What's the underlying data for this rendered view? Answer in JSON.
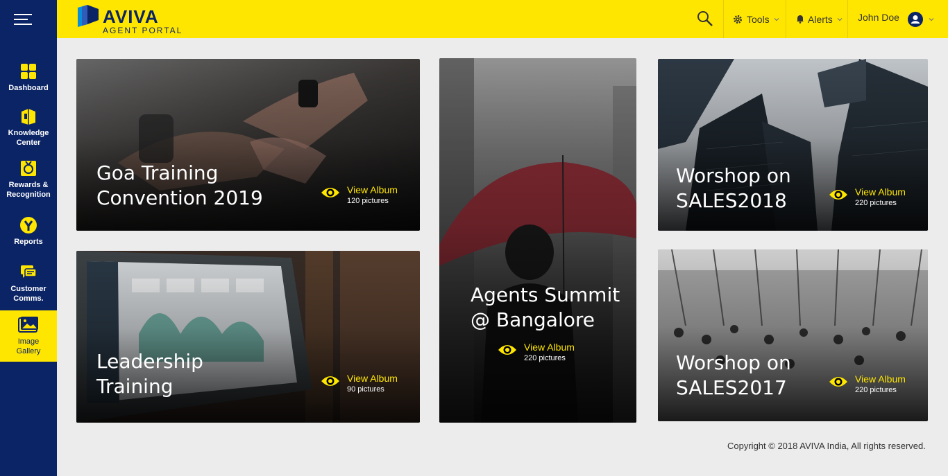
{
  "brand": {
    "name": "AVIVA",
    "subtitle": "AGENT PORTAL"
  },
  "header": {
    "tools_label": "Tools",
    "alerts_label": "Alerts",
    "user_name": "John Doe"
  },
  "sidebar": {
    "items": [
      {
        "label": "Dashboard",
        "icon": "dashboard-icon"
      },
      {
        "label": "Knowledge Center",
        "icon": "book-icon"
      },
      {
        "label": "Rewards & Recognition",
        "icon": "medal-icon"
      },
      {
        "label": "Reports",
        "icon": "reports-icon"
      },
      {
        "label": "Customer Comms.",
        "icon": "chat-icon"
      },
      {
        "label": "Image Gallery",
        "icon": "image-icon",
        "active": true
      }
    ]
  },
  "albums": [
    {
      "title_line1": "Goa Training",
      "title_line2": "Convention 2019",
      "view_label": "View Album",
      "count": "120 pictures"
    },
    {
      "title_line1": "Leadership",
      "title_line2": "Training",
      "view_label": "View Album",
      "count": "90 pictures"
    },
    {
      "title_line1": "Agents Summit",
      "title_line2": "@ Bangalore",
      "view_label": "View Album",
      "count": "220 pictures"
    },
    {
      "title_line1": "Worshop on",
      "title_line2": "SALES2018",
      "view_label": "View Album",
      "count": "220 pictures"
    },
    {
      "title_line1": "Worshop on",
      "title_line2": "SALES2017",
      "view_label": "View Album",
      "count": "220 pictures"
    }
  ],
  "footer": {
    "copyright": "Copyright  © 2018 AVIVA India, All rights reserved."
  },
  "colors": {
    "brand_navy": "#0b2466",
    "brand_yellow": "#ffe600"
  }
}
